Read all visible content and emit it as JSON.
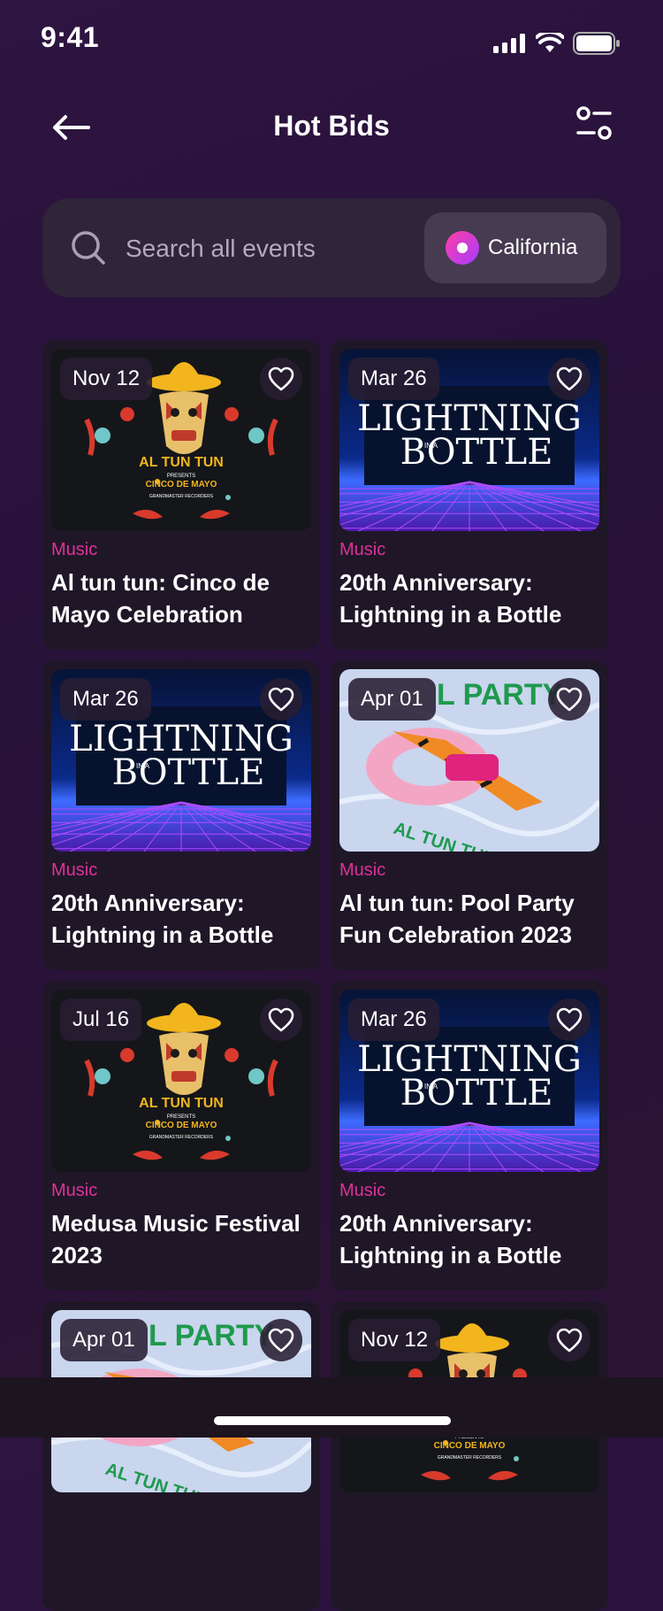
{
  "status": {
    "time": "9:41"
  },
  "header": {
    "title": "Hot Bids"
  },
  "search": {
    "placeholder": "Search all events",
    "location": "California"
  },
  "cards": [
    {
      "date": "Nov 12",
      "category": "Music",
      "title": "Al tun tun: Cinco de Mayo Celebration",
      "poster": "mayo"
    },
    {
      "date": "Mar 26",
      "category": "Music",
      "title": "20th Anniversary: Lightning in a Bottle",
      "poster": "light"
    },
    {
      "date": "Mar 26",
      "category": "Music",
      "title": "20th Anniversary: Lightning in a Bottle",
      "poster": "light"
    },
    {
      "date": "Apr 01",
      "category": "Music",
      "title": "Al tun tun: Pool Party Fun Celebration 2023",
      "poster": "pool"
    },
    {
      "date": "Jul 16",
      "category": "Music",
      "title": "Medusa Music Festival 2023",
      "poster": "mayo"
    },
    {
      "date": "Mar 26",
      "category": "Music",
      "title": "20th Anniversary: Lightning in a Bottle",
      "poster": "light"
    },
    {
      "date": "Apr 01",
      "category": "",
      "title": "",
      "poster": "pool"
    },
    {
      "date": "Nov 12",
      "category": "",
      "title": "",
      "poster": "mayo"
    }
  ],
  "posters": {
    "mayo": {
      "line1": "AL TUN TUN",
      "line2": "PRESENTS",
      "line3": "CINCO DE MAYO",
      "line4": "GRANDMASTER RECORDERS"
    },
    "light": {
      "line1": "LIGHTNING",
      "line2": "IN A",
      "line3": "BOTTLE"
    },
    "pool": {
      "line1": "L PARTY",
      "line2": "AL TUN TUN"
    }
  },
  "icons": {
    "back": "arrow-left-icon",
    "filter": "sliders-icon",
    "search": "search-icon",
    "location": "location-pin-icon",
    "heart": "heart-icon"
  },
  "colors": {
    "accent": "#e0309a",
    "background": "#2a1338",
    "card": "#1f1727"
  }
}
